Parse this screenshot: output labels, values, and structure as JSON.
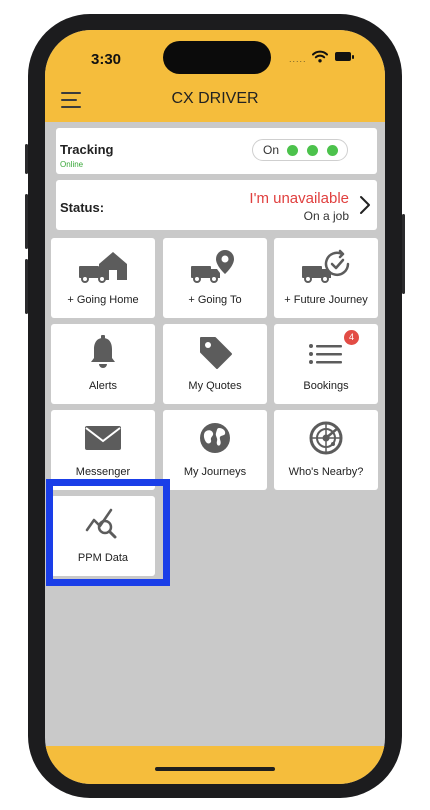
{
  "status_bar": {
    "time": "3:30",
    "signal": "....."
  },
  "header": {
    "title": "CX DRIVER"
  },
  "tracking": {
    "label": "Tracking",
    "sub": "Online",
    "toggle_label": "On"
  },
  "status": {
    "label": "Status:",
    "main": "I'm unavailable",
    "sub": "On a job"
  },
  "tiles": [
    {
      "label": "+ Going Home",
      "icon": "truck-home-icon"
    },
    {
      "label": "+ Going To",
      "icon": "truck-pin-icon"
    },
    {
      "label": "+ Future Journey",
      "icon": "truck-clock-check-icon"
    },
    {
      "label": "Alerts",
      "icon": "bell-icon"
    },
    {
      "label": "My Quotes",
      "icon": "tag-icon"
    },
    {
      "label": "Bookings",
      "icon": "list-icon",
      "badge": "4"
    },
    {
      "label": "Messenger",
      "icon": "envelope-icon"
    },
    {
      "label": "My Journeys",
      "icon": "globe-icon"
    },
    {
      "label": "Who's Nearby?",
      "icon": "radar-icon"
    },
    {
      "label": "PPM Data",
      "icon": "chart-search-icon"
    }
  ],
  "colors": {
    "brand_yellow": "#f5bd3c",
    "online_green": "#4cc24c",
    "unavailable_red": "#e0403f",
    "highlight_blue": "#1a3ee8",
    "badge_red": "#e24c45"
  }
}
